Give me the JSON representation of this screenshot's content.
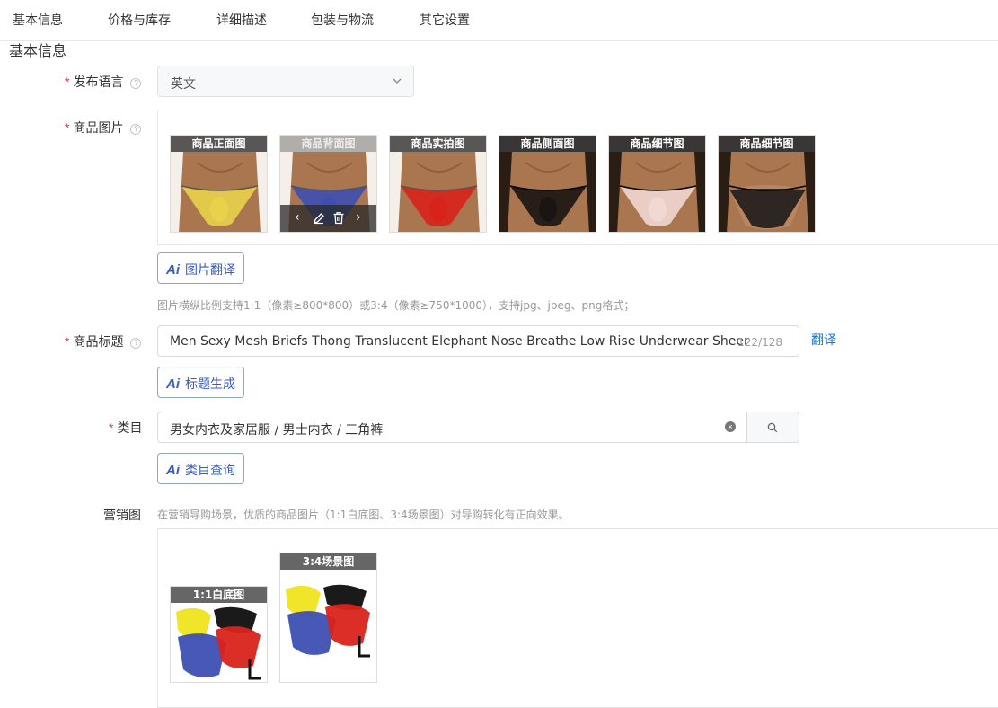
{
  "tabs": [
    "基本信息",
    "价格与库存",
    "详细描述",
    "包装与物流",
    "其它设置"
  ],
  "section_title": "基本信息",
  "language": {
    "label": "发布语言",
    "value": "英文"
  },
  "images": {
    "label": "商品图片",
    "items": [
      {
        "caption": "商品正面图",
        "color": "#e8d24a"
      },
      {
        "caption": "商品背面图",
        "color": "#3d4fb3"
      },
      {
        "caption": "商品实拍图",
        "color": "#d8231b"
      },
      {
        "caption": "商品侧面图",
        "color": "#1a1512"
      },
      {
        "caption": "商品细节图",
        "color": "#f1d8d3"
      },
      {
        "caption": "商品细节图",
        "color": "#151515"
      }
    ],
    "translate_button": "图片翻译",
    "hint": "图片横纵比例支持1:1（像素≥800*800）或3:4（像素≥750*1000），支持jpg、jpeg、png格式；"
  },
  "title": {
    "label": "商品标题",
    "value": "Men Sexy Mesh Briefs Thong Translucent Elephant Nose Breathe Low Rise Underwear Sheer",
    "count": "122/128",
    "translate_link": "翻译",
    "generate_button": "标题生成"
  },
  "category": {
    "label": "类目",
    "value": "男女内衣及家居服 / 男士内衣 / 三角裤",
    "query_button": "类目查询"
  },
  "marketing": {
    "label": "营销图",
    "hint": "在营销导购场景，优质的商品图片（1:1白底图、3:4场景图）对导购转化有正向效果。",
    "items": [
      {
        "caption": "1:1白底图"
      },
      {
        "caption": "3:4场景图"
      }
    ]
  },
  "ai_mark": "Ai",
  "required_mark": "*",
  "help_mark": "?"
}
